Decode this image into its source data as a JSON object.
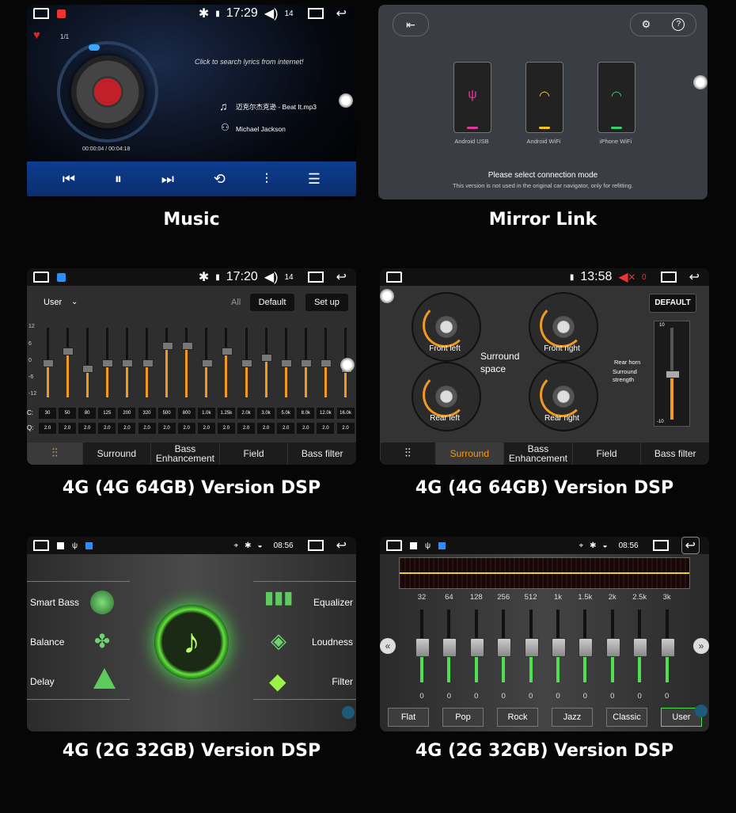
{
  "colors": {
    "accent_orange": "#f39a1e",
    "music_blue": "#1e6fd8",
    "eq_green": "#4fe04f"
  },
  "captions": {
    "music": "Music",
    "mirror": "Mirror Link",
    "dsp_a": "4G (4G 64GB) Version DSP",
    "dsp_b": "4G (4G 64GB) Version DSP",
    "dsp_c": "4G (2G 32GB) Version DSP",
    "dsp_d": "4G (2G 32GB) Version DSP"
  },
  "music": {
    "time": "17:29",
    "volume": "14",
    "counter": "1/1",
    "lyrics_hint": "Click to search lyrics from internet!",
    "track": "迈克尔杰克逊 - Beat It.mp3",
    "artist": "Michael Jackson",
    "progress_text": "00:00:04 / 00:04:18",
    "progress": 0.015,
    "controls": [
      "prev-icon",
      "pause-icon",
      "next-icon",
      "repeat-icon",
      "eq-icon",
      "list-icon"
    ]
  },
  "mirror": {
    "options": [
      {
        "label": "Android USB",
        "icon": "usb-icon",
        "color": "#e0399a"
      },
      {
        "label": "Android WiFi",
        "icon": "wifi-icon",
        "color": "#f2c418"
      },
      {
        "label": "iPhone WiFi",
        "icon": "wifi-icon",
        "color": "#35d06a"
      }
    ],
    "prompt": "Please select connection mode",
    "note": "This version is not used in the original car navigator, only for refitting."
  },
  "eq1": {
    "time": "17:20",
    "volume": "14",
    "preset": "User",
    "all_label": "All",
    "default_label": "Default",
    "setup_label": "Set up",
    "scale": [
      "12",
      "6",
      "0",
      "-6",
      "-12"
    ],
    "row_label_freq": "C:",
    "row_label_q": "Q:",
    "freqs": [
      "30",
      "50",
      "80",
      "125",
      "200",
      "320",
      "500",
      "800",
      "1.0k",
      "1.25k",
      "2.0k",
      "3.0k",
      "5.0k",
      "8.0k",
      "12.0k",
      "16.0k"
    ],
    "q": [
      "2.0",
      "2.0",
      "2.0",
      "2.0",
      "2.0",
      "2.0",
      "2.0",
      "2.0",
      "2.0",
      "2.0",
      "2.0",
      "2.0",
      "2.0",
      "2.0",
      "2.0",
      "2.0"
    ],
    "levels": [
      0,
      2,
      -1,
      0,
      0,
      0,
      3,
      3,
      0,
      2,
      0,
      1,
      0,
      0,
      0,
      -1
    ],
    "tabs": [
      "Surround",
      "Bass Enhancement",
      "Field",
      "Bass filter"
    ]
  },
  "surround": {
    "time": "13:58",
    "volume": "0",
    "default_label": "DEFAULT",
    "center_label": "Surround space",
    "knobs": [
      "Front left",
      "Front right",
      "Rear left",
      "Rear right"
    ],
    "rear_horn": "Rear horn",
    "surround_strength": "Surround strength",
    "scale_top": "10",
    "scale_bottom": "-10",
    "strength_level": 0.5,
    "tabs": [
      "Surround",
      "Bass Enhancement",
      "Field",
      "Bass filter"
    ]
  },
  "dsp2": {
    "time": "08:56",
    "left_items": [
      "Smart Bass",
      "Balance",
      "Delay"
    ],
    "right_items": [
      "Equalizer",
      "Loudness",
      "Filter"
    ]
  },
  "eq2": {
    "time": "08:56",
    "freqs": [
      "32",
      "64",
      "128",
      "256",
      "512",
      "1k",
      "1.5k",
      "2k",
      "2.5k",
      "3k"
    ],
    "values": [
      "0",
      "0",
      "0",
      "0",
      "0",
      "0",
      "0",
      "0",
      "0",
      "0"
    ],
    "presets": [
      "Flat",
      "Pop",
      "Rock",
      "Jazz",
      "Classic",
      "User"
    ],
    "active_preset": "User"
  }
}
